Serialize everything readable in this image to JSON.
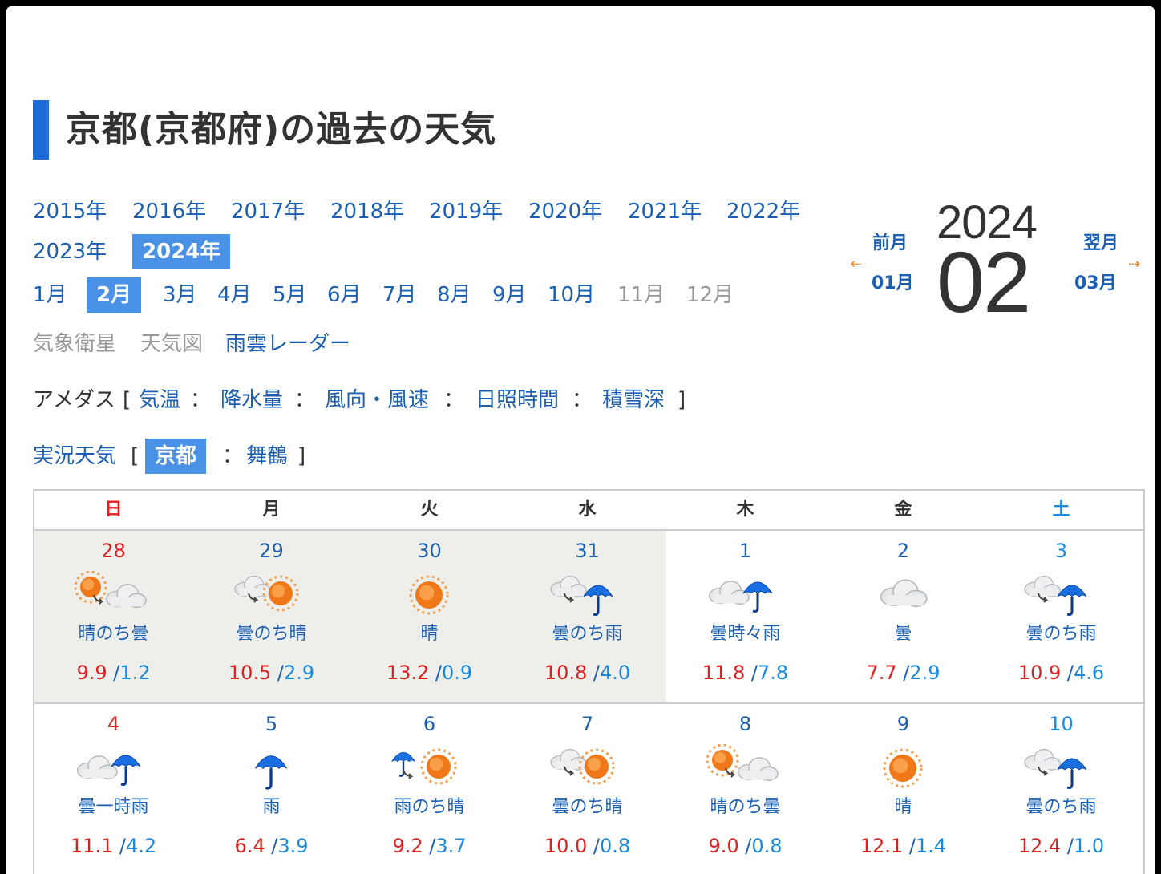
{
  "title": "京都(京都府)の過去の天気",
  "years": [
    {
      "label": "2015年",
      "selected": false
    },
    {
      "label": "2016年",
      "selected": false
    },
    {
      "label": "2017年",
      "selected": false
    },
    {
      "label": "2018年",
      "selected": false
    },
    {
      "label": "2019年",
      "selected": false
    },
    {
      "label": "2020年",
      "selected": false
    },
    {
      "label": "2021年",
      "selected": false
    },
    {
      "label": "2022年",
      "selected": false
    },
    {
      "label": "2023年",
      "selected": false
    },
    {
      "label": "2024年",
      "selected": true
    }
  ],
  "months": [
    {
      "label": "1月",
      "state": "link"
    },
    {
      "label": "2月",
      "state": "selected"
    },
    {
      "label": "3月",
      "state": "link"
    },
    {
      "label": "4月",
      "state": "link"
    },
    {
      "label": "5月",
      "state": "link"
    },
    {
      "label": "6月",
      "state": "link"
    },
    {
      "label": "7月",
      "state": "link"
    },
    {
      "label": "8月",
      "state": "link"
    },
    {
      "label": "9月",
      "state": "link"
    },
    {
      "label": "10月",
      "state": "link"
    },
    {
      "label": "11月",
      "state": "disabled"
    },
    {
      "label": "12月",
      "state": "disabled"
    }
  ],
  "maps": {
    "satellite": "気象衛星",
    "weather_map": "天気図",
    "radar": "雨雲レーダー"
  },
  "amedas": {
    "label": "アメダス",
    "open": "[",
    "close": "]",
    "sep": "：",
    "items": [
      "気温",
      "降水量",
      "風向・風速",
      "日照時間",
      "積雪深"
    ]
  },
  "actual": {
    "label": "実況天気",
    "open": "[",
    "close": "]",
    "sep": "：",
    "items": [
      {
        "label": "京都",
        "selected": true
      },
      {
        "label": "舞鶴",
        "selected": false
      }
    ]
  },
  "nav": {
    "year": "2024",
    "month": "02",
    "prev_label": "前月",
    "prev_month": "01月",
    "next_label": "翌月",
    "next_month": "03月",
    "prev_arrow": "⇠",
    "next_arrow": "⇢"
  },
  "calendar": {
    "weekdays": [
      "日",
      "月",
      "火",
      "水",
      "木",
      "金",
      "土"
    ],
    "weeks": [
      [
        {
          "day": "28",
          "weather": "晴のち曇",
          "icon": "sun-then-cloud-icon",
          "max": "9.9",
          "min": "1.2",
          "prev": true
        },
        {
          "day": "29",
          "weather": "曇のち晴",
          "icon": "cloud-then-sun-icon",
          "max": "10.5",
          "min": "2.9",
          "prev": true
        },
        {
          "day": "30",
          "weather": "晴",
          "icon": "sun-icon",
          "max": "13.2",
          "min": "0.9",
          "prev": true
        },
        {
          "day": "31",
          "weather": "曇のち雨",
          "icon": "cloud-then-rain-icon",
          "max": "10.8",
          "min": "4.0",
          "prev": true
        },
        {
          "day": "1",
          "weather": "曇時々雨",
          "icon": "cloud-sometimes-rain-icon",
          "max": "11.8",
          "min": "7.8",
          "prev": false
        },
        {
          "day": "2",
          "weather": "曇",
          "icon": "cloud-icon",
          "max": "7.7",
          "min": "2.9",
          "prev": false
        },
        {
          "day": "3",
          "weather": "曇のち雨",
          "icon": "cloud-then-rain-icon",
          "max": "10.9",
          "min": "4.6",
          "prev": false
        }
      ],
      [
        {
          "day": "4",
          "weather": "曇一時雨",
          "icon": "cloud-occasional-rain-icon",
          "max": "11.1",
          "min": "4.2",
          "prev": false
        },
        {
          "day": "5",
          "weather": "雨",
          "icon": "rain-icon",
          "max": "6.4",
          "min": "3.9",
          "prev": false
        },
        {
          "day": "6",
          "weather": "雨のち晴",
          "icon": "rain-then-sun-icon",
          "max": "9.2",
          "min": "3.7",
          "prev": false
        },
        {
          "day": "7",
          "weather": "曇のち晴",
          "icon": "cloud-then-sun-icon",
          "max": "10.0",
          "min": "0.8",
          "prev": false
        },
        {
          "day": "8",
          "weather": "晴のち曇",
          "icon": "sun-then-cloud-icon",
          "max": "9.0",
          "min": "0.8",
          "prev": false
        },
        {
          "day": "9",
          "weather": "晴",
          "icon": "sun-icon",
          "max": "12.1",
          "min": "1.4",
          "prev": false
        },
        {
          "day": "10",
          "weather": "曇のち雨",
          "icon": "cloud-then-rain-icon",
          "max": "12.4",
          "min": "1.0",
          "prev": false
        }
      ]
    ],
    "temp_sep": "/"
  },
  "colors": {
    "link": "#1a5fb4",
    "selected_bg": "#4a92e8",
    "sunday": "#e02020",
    "saturday": "#1a8ae0",
    "max_temp": "#e02020",
    "min_temp": "#1a8ae0",
    "prev_month_bg": "#eeeeeb",
    "title_bar": "#1f6bd6",
    "nav_arrow": "#f08020"
  }
}
